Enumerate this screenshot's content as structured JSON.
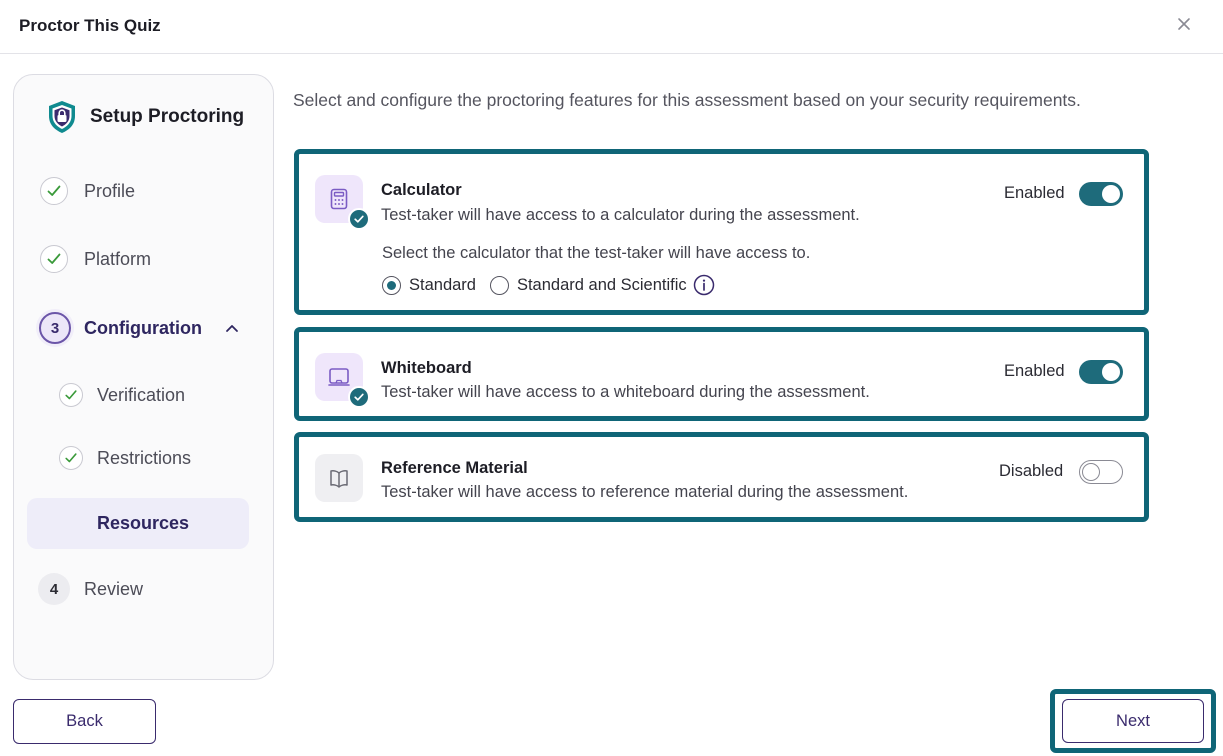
{
  "header": {
    "title": "Proctor This Quiz",
    "close_icon": "close-icon"
  },
  "sidebar": {
    "heading": "Setup Proctoring",
    "heading_icon": "shield-lock-icon",
    "steps": [
      {
        "label": "Profile",
        "state": "complete"
      },
      {
        "label": "Platform",
        "state": "complete"
      },
      {
        "label": "Configuration",
        "number": "3",
        "state": "active"
      },
      {
        "label": "Verification",
        "state": "complete"
      },
      {
        "label": "Restrictions",
        "state": "complete"
      },
      {
        "label": "Resources",
        "state": "current"
      },
      {
        "label": "Review",
        "number": "4",
        "state": "pending"
      }
    ]
  },
  "main": {
    "intro": "Select and configure the proctoring features for this assessment based on your security requirements.",
    "cards": [
      {
        "title": "Calculator",
        "description": "Test-taker will have access to a calculator during the assessment.",
        "status": "Enabled",
        "enabled": true,
        "icon": "calculator-icon",
        "sub_label": "Select the calculator that the test-taker will have access to.",
        "options": [
          {
            "label": "Standard",
            "selected": true
          },
          {
            "label": "Standard and Scientific",
            "selected": false
          }
        ]
      },
      {
        "title": "Whiteboard",
        "description": "Test-taker will have access to a whiteboard during the assessment.",
        "status": "Enabled",
        "enabled": true,
        "icon": "whiteboard-icon"
      },
      {
        "title": "Reference Material",
        "description": "Test-taker will have access to reference material during the assessment.",
        "status": "Disabled",
        "enabled": false,
        "icon": "book-icon"
      }
    ]
  },
  "footer": {
    "back_label": "Back",
    "next_label": "Next"
  },
  "colors": {
    "accent_teal": "#1e6b7b",
    "highlight_border": "#0f6577",
    "brand_purple": "#3a2b6d",
    "icon_bg_purple": "#efe6fb",
    "check_green": "#3a9a3a"
  }
}
